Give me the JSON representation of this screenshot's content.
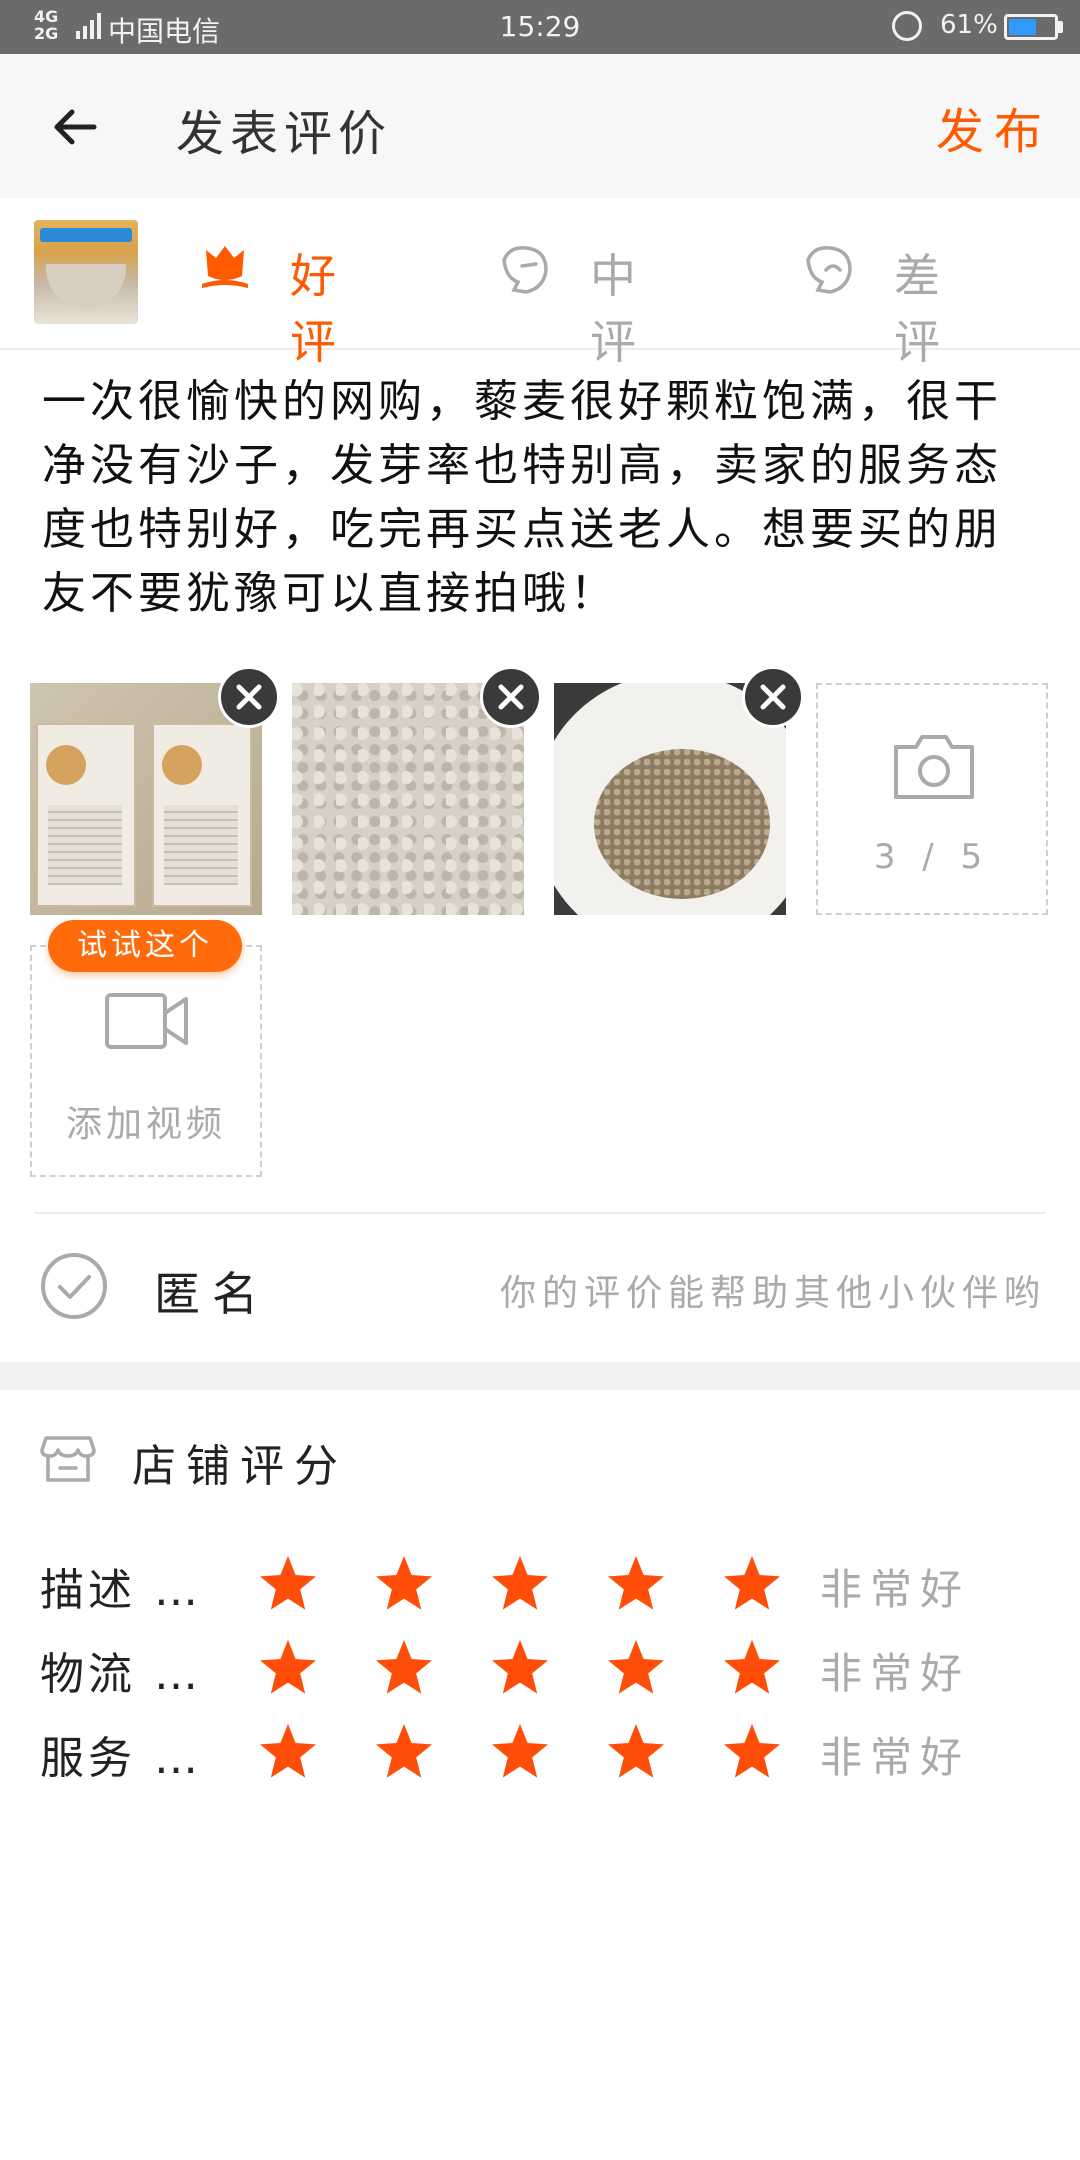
{
  "status_bar": {
    "network": "4G\n2G",
    "carrier": "中国电信",
    "time": "15:29",
    "battery_percent": "61%",
    "battery_level": 0.61
  },
  "header": {
    "title": "发表评价",
    "publish_label": "发布"
  },
  "rating_tabs": [
    {
      "label": "好评",
      "selected": true
    },
    {
      "label": "中评",
      "selected": false
    },
    {
      "label": "差评",
      "selected": false
    }
  ],
  "review_text": "一次很愉快的网购，藜麦很好颗粒饱满，很干净没有沙子，发芽率也特别高，卖家的服务态度也特别好，吃完再买点送老人。想要买的朋友不要犹豫可以直接拍哦！",
  "photos": {
    "count_label": "3 / 5",
    "uploaded": 3,
    "max": 5
  },
  "video": {
    "badge": "试试这个",
    "label": "添加视频"
  },
  "anonymous": {
    "label": "匿名",
    "hint": "你的评价能帮助其他小伙伴哟",
    "checked": false
  },
  "shop_rating": {
    "title": "店铺评分",
    "rows": [
      {
        "label": "描述 …",
        "stars": 5,
        "text": "非常好"
      },
      {
        "label": "物流 …",
        "stars": 5,
        "text": "非常好"
      },
      {
        "label": "服务 …",
        "stars": 5,
        "text": "非常好"
      }
    ]
  },
  "colors": {
    "accent": "#ff5a00",
    "star": "#ff4e0a",
    "muted": "#aaaaaa"
  },
  "icons": [
    "back-arrow-icon",
    "flower-icon",
    "neutral-face-icon",
    "bad-face-icon",
    "close-icon",
    "camera-icon",
    "video-icon",
    "check-circle-icon",
    "shop-icon",
    "star-icon"
  ]
}
